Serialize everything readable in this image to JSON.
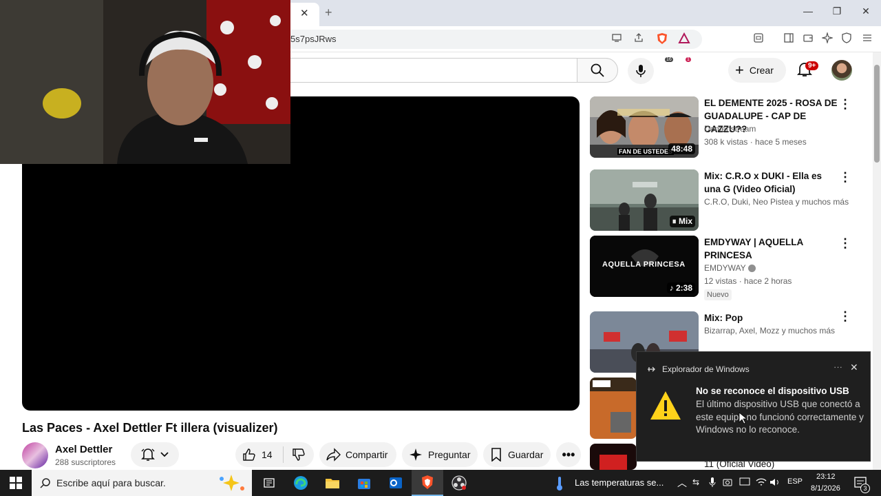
{
  "browser": {
    "url_fragment": "5s7psJRws",
    "shield_badge": "16",
    "alert_badge": "1"
  },
  "youtube_header": {
    "create_label": "Crear",
    "notifications_badge": "9+"
  },
  "video": {
    "title": "Las Paces - Axel Dettler Ft illera (visualizer)",
    "channel_name": "Axel Dettler",
    "subscribers": "288 suscriptores",
    "likes": "14",
    "share_label": "Compartir",
    "ask_label": "Preguntar",
    "save_label": "Guardar"
  },
  "recommendations": [
    {
      "title": "EL DEMENTE 2025 - ROSA DE GUADALUPE - CAP DE CAZZU??",
      "channel": "Demenstream",
      "meta": "308 k vistas · hace 5 meses",
      "duration": "48:48",
      "thumb_caption": "FAN DE USTEDES"
    },
    {
      "title": "Mix: C.R.O x DUKI - Ella es una G (Video Oficial)",
      "channel": "C.R.O, Duki, Neo Pistea y muchos más",
      "duration": "Mix"
    },
    {
      "title": "EMDYWAY | AQUELLA PRINCESA",
      "channel": "EMDYWAY",
      "meta": "12 vistas · hace 2 horas",
      "duration": "2:38",
      "badge": "Nuevo",
      "thumb_caption": "AQUELLA PRINCESA"
    },
    {
      "title": "Mix: Pop",
      "channel": "Bizarrap, Axel, Mozz y muchos más"
    },
    {
      "title": "",
      "partial_text": "11 (Oficial Video)"
    }
  ],
  "toast": {
    "app": "Explorador de Windows",
    "title": "No se reconoce el dispositivo USB",
    "body": "El último dispositivo USB que conectó a este equipo no funcionó correctamente y Windows no lo reconoce."
  },
  "taskbar": {
    "search_placeholder": "Escribe aquí para buscar.",
    "weather_text": "Las temperaturas se...",
    "language": "ESP",
    "time": "23:12",
    "date": "8/1/2026",
    "notification_count": "3"
  },
  "colors": {
    "accent_red": "#cc0000",
    "brave_orange": "#fb542b",
    "toast_bg": "#1f1f1f",
    "taskbar_bg": "#1c1c1c"
  }
}
